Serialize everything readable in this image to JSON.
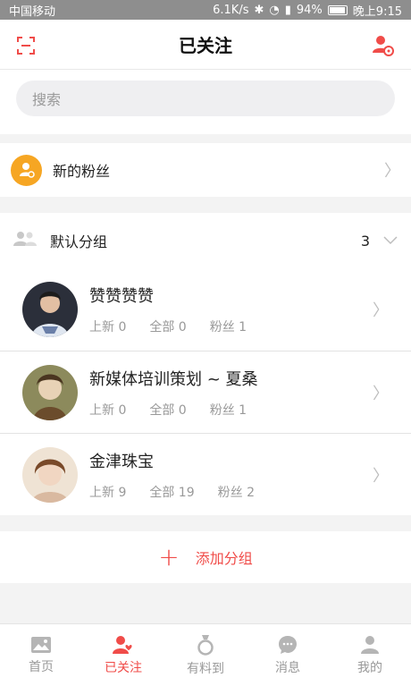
{
  "status_bar": {
    "carrier": "中国移动",
    "speed": "6.1K/s",
    "battery": "94%",
    "time": "晚上9:15"
  },
  "header": {
    "title": "已关注"
  },
  "search": {
    "placeholder": "搜索"
  },
  "new_fans": {
    "label": "新的粉丝"
  },
  "group": {
    "label": "默认分组",
    "count": "3"
  },
  "follows": [
    {
      "name": "赞赞赞赞",
      "new": "上新 0",
      "all": "全部 0",
      "fans": "粉丝 1"
    },
    {
      "name": "新媒体培训策划 ~ 夏桑",
      "new": "上新 0",
      "all": "全部 0",
      "fans": "粉丝 1"
    },
    {
      "name": "金津珠宝",
      "new": "上新 9",
      "all": "全部 19",
      "fans": "粉丝 2"
    }
  ],
  "add_group": {
    "label": "添加分组"
  },
  "tabs": [
    {
      "label": "首页",
      "icon": "image-icon"
    },
    {
      "label": "已关注",
      "icon": "followed-icon"
    },
    {
      "label": "有料到",
      "icon": "ring-icon"
    },
    {
      "label": "消息",
      "icon": "message-icon"
    },
    {
      "label": "我的",
      "icon": "person-icon"
    }
  ],
  "colors": {
    "accent": "#f04c49",
    "fan_badge": "#f6a623"
  }
}
